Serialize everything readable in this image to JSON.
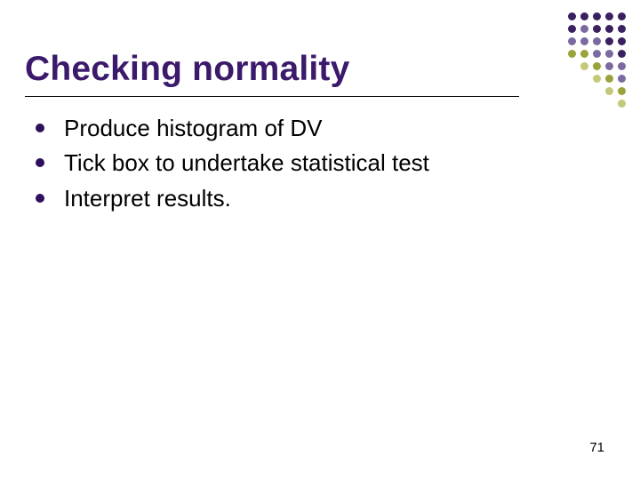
{
  "title": "Checking normality",
  "bullets": [
    "Produce histogram of DV",
    "Tick box to undertake statistical test",
    "Interpret results."
  ],
  "page_number": "71"
}
